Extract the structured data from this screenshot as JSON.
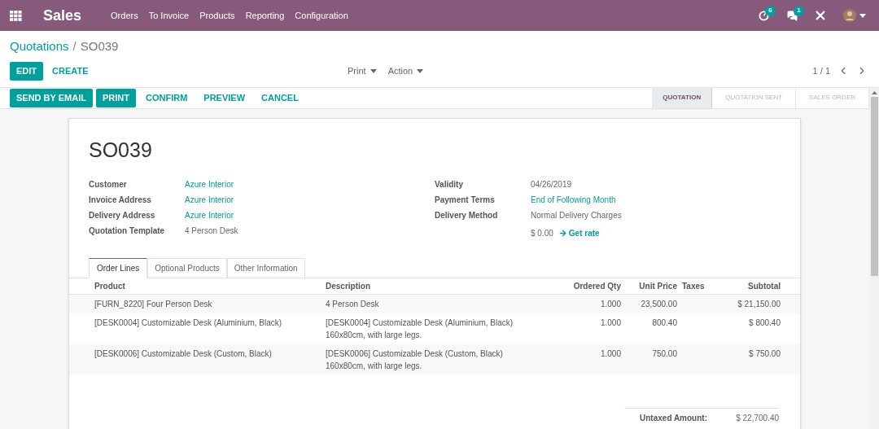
{
  "navbar": {
    "app_title": "Sales",
    "menu": [
      "Orders",
      "To Invoice",
      "Products",
      "Reporting",
      "Configuration"
    ],
    "activity_count": "6",
    "message_count": "1"
  },
  "breadcrumb": {
    "parent": "Quotations",
    "separator": "/",
    "current": "SO039"
  },
  "buttons": [
    {
      "label": "EDIT",
      "kind": "primary"
    },
    {
      "label": "CREATE",
      "kind": "link"
    }
  ],
  "dropdowns": [
    "Print",
    "Action"
  ],
  "pager": "1 / 1",
  "actions": [
    {
      "label": "SEND BY EMAIL",
      "kind": "primary"
    },
    {
      "label": "PRINT",
      "kind": "primary"
    },
    {
      "label": "CONFIRM",
      "kind": "link"
    },
    {
      "label": "PREVIEW",
      "kind": "link"
    },
    {
      "label": "CANCEL",
      "kind": "link"
    }
  ],
  "stages": [
    {
      "label": "QUOTATION",
      "selected": true
    },
    {
      "label": "QUOTATION SENT",
      "selected": false
    },
    {
      "label": "SALES ORDER",
      "selected": false
    }
  ],
  "form": {
    "title": "SO039",
    "left_fields": [
      {
        "label": "Customer",
        "value": "Azure Interior",
        "link": true
      },
      {
        "label": "Invoice Address",
        "value": "Azure Interior",
        "link": true
      },
      {
        "label": "Delivery Address",
        "value": "Azure Interior",
        "link": true
      },
      {
        "label": "Quotation Template",
        "value": "4 Person Desk",
        "link": false
      }
    ],
    "right_fields": [
      {
        "label": "Validity",
        "value": "04/26/2019",
        "link": false
      },
      {
        "label": "Payment Terms",
        "value": "End of Following Month",
        "link": true
      },
      {
        "label": "Delivery Method",
        "value": "Normal Delivery Charges",
        "link": false
      }
    ],
    "delivery_amount": "$ 0.00",
    "get_rate": "Get rate"
  },
  "tabs": [
    {
      "label": "Order Lines",
      "selected": true
    },
    {
      "label": "Optional Products",
      "selected": false
    },
    {
      "label": "Other Information",
      "selected": false
    }
  ],
  "table": {
    "columns": [
      "Product",
      "Description",
      "Ordered Qty",
      "Unit Price",
      "Taxes",
      "Subtotal"
    ],
    "rows": [
      {
        "product": "[FURN_8220] Four Person Desk",
        "description": [
          "4 Person Desk"
        ],
        "qty": "1.000",
        "unit_price": "23,500.00",
        "subtotal": "$ 21,150.00"
      },
      {
        "product": "[DESK0004] Customizable Desk (Aluminium, Black)",
        "description": [
          "[DESK0004] Customizable Desk (Aluminium, Black)",
          "160x80cm, with large legs."
        ],
        "qty": "1.000",
        "unit_price": "800.40",
        "subtotal": "$ 800.40"
      },
      {
        "product": "[DESK0006] Customizable Desk (Custom, Black)",
        "description": [
          "[DESK0006] Customizable Desk (Custom, Black)",
          "160x80cm, with large legs."
        ],
        "qty": "1.000",
        "unit_price": "750.00",
        "subtotal": "$ 750.00"
      }
    ]
  },
  "totals": [
    {
      "label": "Untaxed Amount:",
      "value": "$ 22,700.40"
    }
  ]
}
